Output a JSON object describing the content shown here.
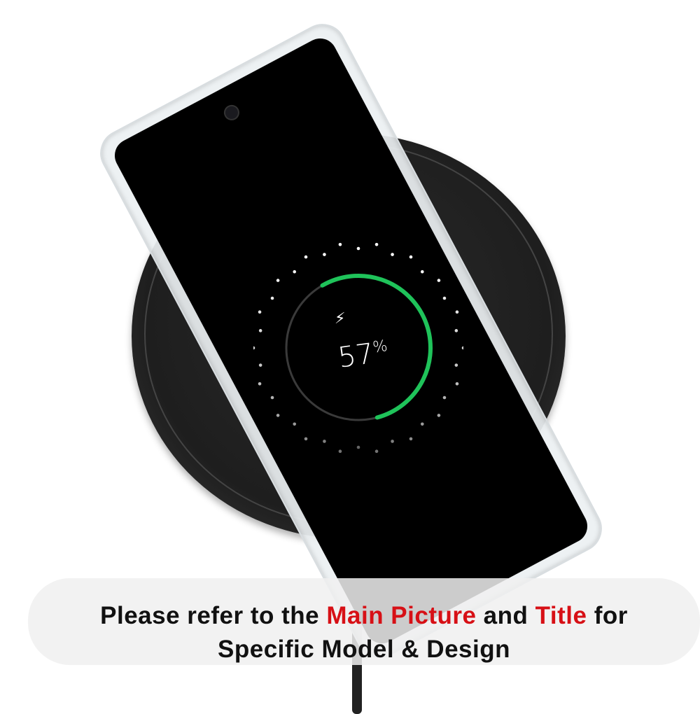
{
  "phone_screen": {
    "battery_percent": 57,
    "battery_label": "57",
    "percent_sign": "%",
    "bolt_icon": "lightning-bolt-icon",
    "ring_color": "#1fc35a"
  },
  "banner": {
    "line1": {
      "part1": "Please refer to the ",
      "highlight1": "Main Picture",
      "part2": " and ",
      "highlight2": "Title",
      "part3": " for"
    },
    "line2": "Specific Model & Design",
    "highlight_color": "#d71016"
  }
}
